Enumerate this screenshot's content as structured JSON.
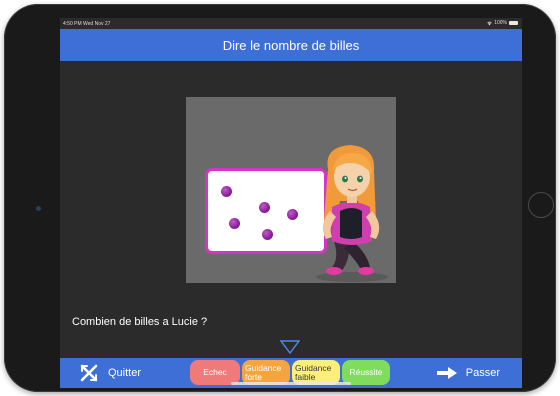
{
  "status_bar": {
    "time": "4:50 PM  Wed Nov 27",
    "battery": "100%"
  },
  "header": {
    "title": "Dire le nombre de billes"
  },
  "exercise": {
    "question": "Combien de billes a Lucie ?",
    "marble_count": 5,
    "marble_color": "#9b2db0",
    "board_border_color": "#d236c6"
  },
  "footer": {
    "quit_label": "Quitter",
    "skip_label": "Passer",
    "grades": [
      {
        "label": "Echec",
        "color": "#f07a7a"
      },
      {
        "label": "Guidance forte",
        "color": "#f5a540"
      },
      {
        "label": "Guidance faible",
        "color": "#fbef7a"
      },
      {
        "label": "Réussite",
        "color": "#7fdc5c"
      }
    ]
  },
  "icons": {
    "quit": "crossed-arrows-icon",
    "skip": "arrow-right-icon",
    "next": "down-triangle-icon"
  },
  "colors": {
    "accent": "#3d6fd6",
    "background": "#2b2b2b"
  }
}
